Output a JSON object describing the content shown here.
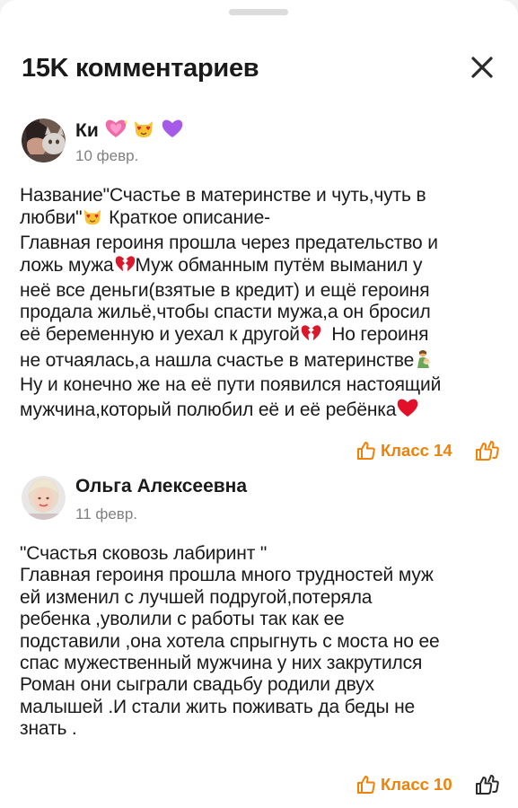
{
  "header": {
    "title": "15K комментариев"
  },
  "comments": [
    {
      "author": "Ки",
      "date": "10 февр.",
      "lines": [
        "Название\"Счастье в материнстве и чуть,чуть в",
        "любви\"",
        " Краткое описание-",
        "Главная героиня прошла через предательство и",
        "ложь мужа",
        "Муж обманным путём выманил у",
        "неё все деньги(взятые в кредит) и ещё героиня",
        "продала жильё,чтобы спасти мужа,а он бросил",
        "её беременную и уехал к другой",
        "  Но героиня",
        "не отчаялась,а нашла счастье в материнстве",
        "Ну и конечно же на её пути появился настоящий",
        "мужчина,который полюбил её и её ребёнка"
      ],
      "likes_label": "Класс 14"
    },
    {
      "author": "Ольга Алексеевна",
      "date": "11 февр.",
      "lines": [
        "\"Счастья сковозь лабиринт \"",
        "Главная героиня прошла много трудностей муж",
        "ей изменил с лучшей подругой,потеряла",
        "ребенка ,уволили с работы так как ее",
        "подставили ,она хотела спрыгнуть с моста но ее",
        "спас мужественный мужчина у них закрутился",
        "Роман они сыграли свадьбу родили двух",
        "малышей .И стали жить поживать да беды не",
        "знать ."
      ],
      "likes_label": "Класс 10"
    }
  ],
  "icons": {
    "close": "close-icon",
    "like": "thumbs-up-icon",
    "reply": "reply-class-icon",
    "name_emojis": [
      "sparkling-heart-emoji",
      "heart-eyes-cat-emoji",
      "purple-heart-emoji"
    ],
    "inline_emojis": [
      "heart-eyes-cat-emoji",
      "broken-heart-emoji",
      "broken-heart-emoji",
      "mother-child-emoji",
      "red-heart-emoji"
    ]
  },
  "colors": {
    "accent": "#ee8208",
    "text": "#1a1a1a",
    "muted": "#808080",
    "background": "#ffffff"
  }
}
